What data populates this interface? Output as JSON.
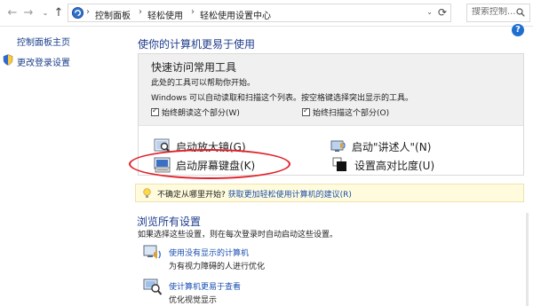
{
  "nav": {
    "back_glyph": "←",
    "forward_glyph": "→",
    "dropdown_glyph": "⌄",
    "up_glyph": "↑"
  },
  "breadcrumb": {
    "items": [
      "控制面板",
      "轻松使用",
      "轻松使用设置中心"
    ],
    "separator": "›",
    "dropdown_glyph": "⌄",
    "refresh_glyph": "⟳"
  },
  "search": {
    "placeholder": "搜索控制..."
  },
  "left_pane": {
    "home_link": "控制面板主页",
    "signin_link": "更改登录设置"
  },
  "main": {
    "title": "使你的计算机更易于使用",
    "help_glyph": "?"
  },
  "quick_access": {
    "title": "快速访问常用工具",
    "line1": "此处的工具可以帮助你开始。",
    "line2": "Windows 可以自动读取和扫描这个列表。按空格键选择突出显示的工具。",
    "check1_label": "始终朗读这个部分(W)",
    "check2_label": "始终扫描这个部分(O)",
    "tools": {
      "magnifier": "启动放大镜(G)",
      "narrator": "启动\"讲述人\"(N)",
      "osk": "启动屏幕键盘(K)",
      "high_contrast": "设置高对比度(U)"
    }
  },
  "tip": {
    "prefix": "不确定从哪里开始?",
    "link": "获取更加轻松使用计算机的建议(R)"
  },
  "browse": {
    "title": "浏览所有设置",
    "description": "如果选择这些设置，则在每次登录时自动启动这些设置。",
    "items": [
      {
        "link": "使用没有显示的计算机",
        "desc": "为有视力障碍的人进行优化"
      },
      {
        "link": "使计算机更易于查看",
        "desc": "优化视觉显示"
      }
    ]
  },
  "colors": {
    "link": "#1a4fb0",
    "heading": "#1e3c8c",
    "highlight_ellipse": "#e0212a",
    "tip_bg": "#fffbdc"
  }
}
